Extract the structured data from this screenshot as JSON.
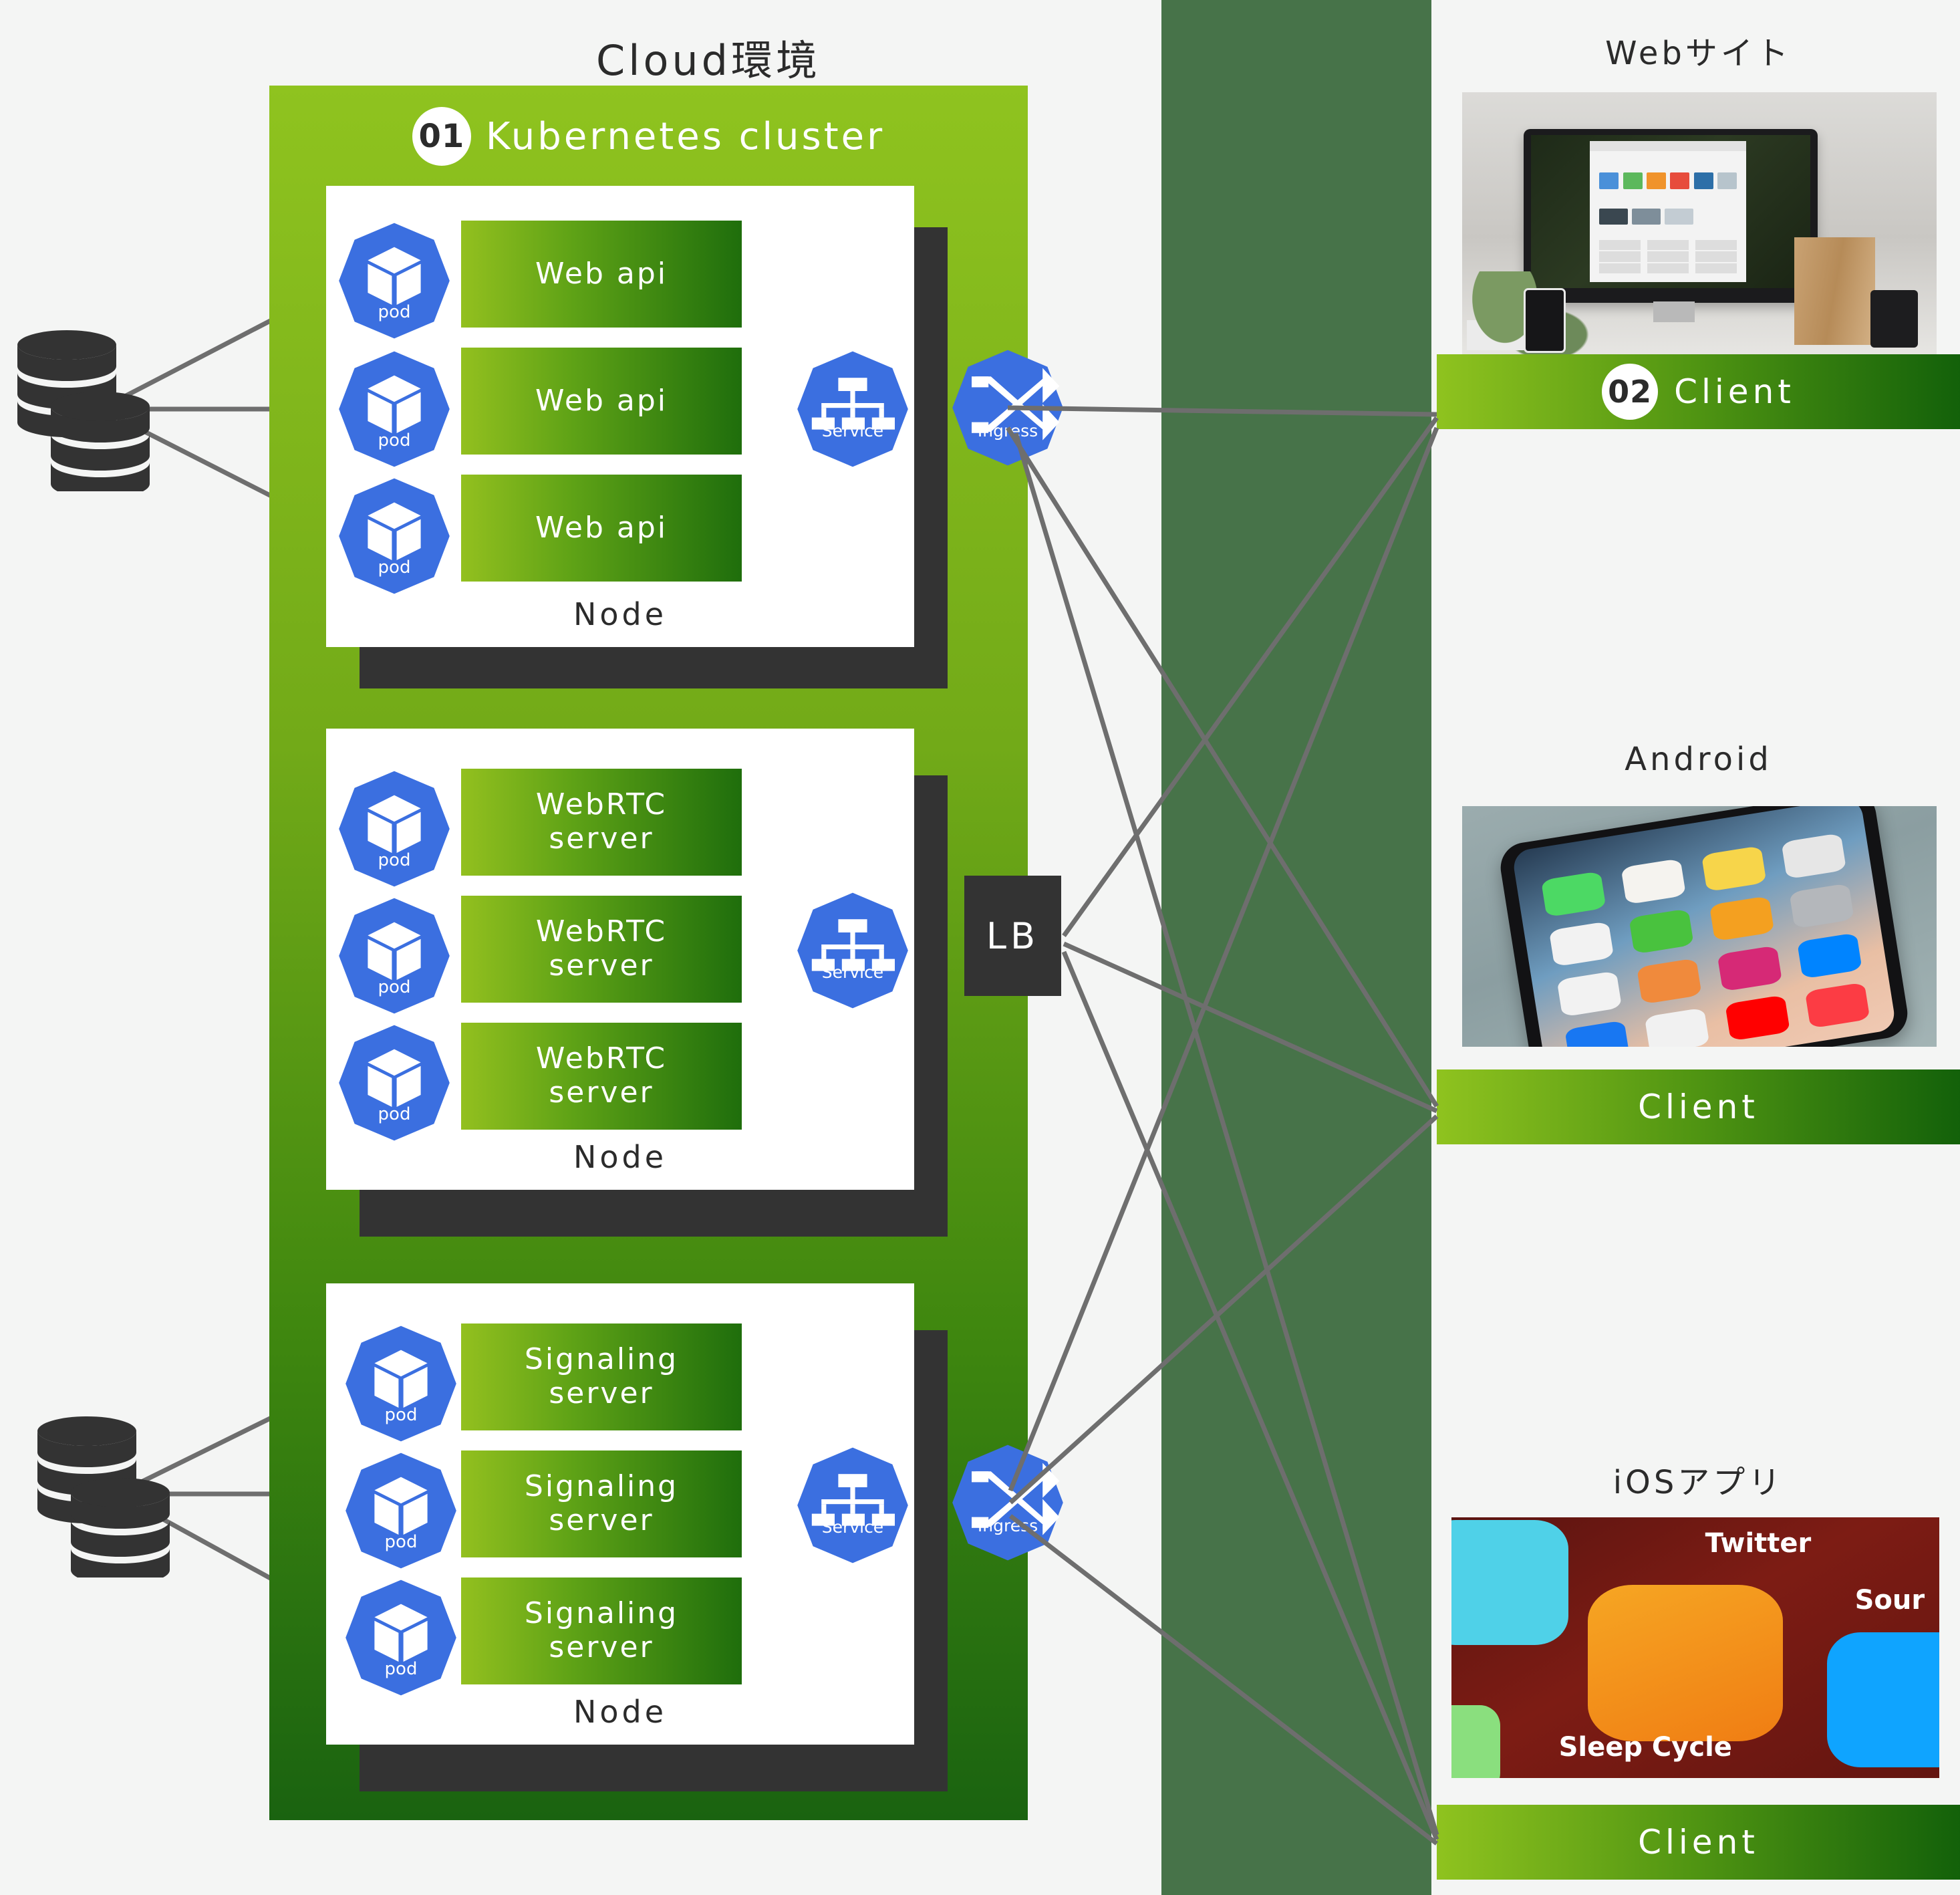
{
  "diagram": {
    "cloud_title": "Cloud環境",
    "cluster": {
      "badge": "01",
      "title": "Kubernetes cluster",
      "node_label": "Node",
      "pod_label": "pod",
      "service_label": "Service",
      "ingress_label": "Ingress",
      "lb_label": "LB"
    },
    "nodes": [
      {
        "name": "web-api-node",
        "label": "Node",
        "workloads": [
          "Web api",
          "Web api",
          "Web api"
        ],
        "pods": [
          "pod",
          "pod",
          "pod"
        ],
        "service": "Service",
        "egress": "Ingress",
        "has_database": true
      },
      {
        "name": "webrtc-node",
        "label": "Node",
        "workloads": [
          "WebRTC server",
          "WebRTC server",
          "WebRTC server"
        ],
        "pods": [
          "pod",
          "pod",
          "pod"
        ],
        "service": "Service",
        "egress": "LB",
        "has_database": false
      },
      {
        "name": "signaling-node",
        "label": "Node",
        "workloads": [
          "Signaling server",
          "Signaling server",
          "Signaling server"
        ],
        "pods": [
          "pod",
          "pod",
          "pod"
        ],
        "service": "Service",
        "egress": "Ingress",
        "has_database": true
      }
    ],
    "clients": [
      {
        "title": "Webサイト",
        "badge": "02",
        "label": "Client",
        "photo": "desktop-imac-photo"
      },
      {
        "title": "Android",
        "badge": "",
        "label": "Client",
        "photo": "android-smartphone-photo"
      },
      {
        "title": "iOSアプリ",
        "badge": "",
        "label": "Client",
        "photo": "ios-app-icons-photo"
      }
    ],
    "icons": {
      "pod": "pod-cube-icon",
      "service": "service-tree-icon",
      "ingress": "ingress-shuffle-arrows-icon",
      "database": "database-cylinder-stack-icon"
    },
    "colors": {
      "cluster_top": "#8FC31F",
      "cluster_bottom": "#1A6310",
      "band": "#477349",
      "k8s_blue": "#3B6FE0",
      "dark": "#333333",
      "wire": "#6E6E6E",
      "page_bg": "#F4F5F4"
    }
  }
}
